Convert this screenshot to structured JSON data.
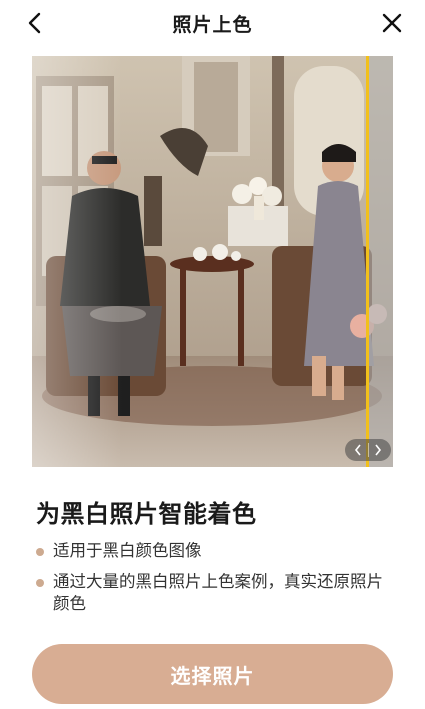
{
  "header": {
    "title": "照片上色",
    "back_icon": "chevron-left-icon",
    "close_icon": "close-icon"
  },
  "preview": {
    "divider_color": "#f2c01b",
    "compare_split_fraction": 0.93
  },
  "info": {
    "heading": "为黑白照片智能着色",
    "features": [
      "适用于黑白颜色图像",
      "通过大量的黑白照片上色案例，真实还原照片颜色"
    ]
  },
  "cta": {
    "label": "选择照片",
    "color": "#d8ad93"
  },
  "colors": {
    "bullet": "#cdaa90"
  }
}
